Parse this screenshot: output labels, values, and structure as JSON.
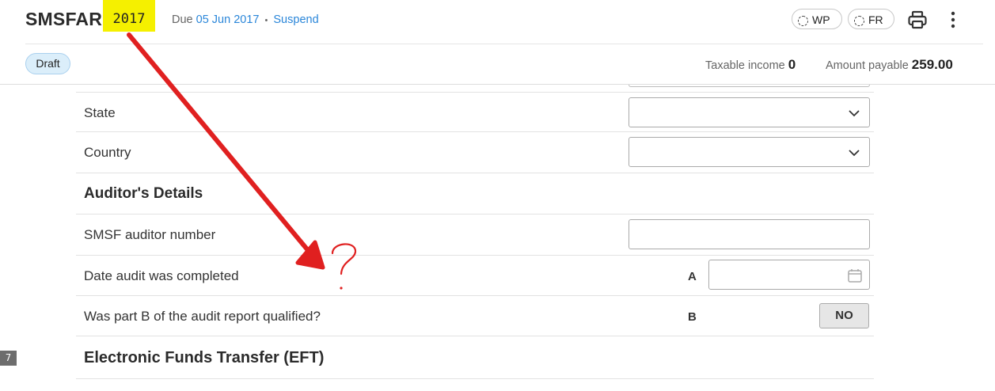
{
  "header": {
    "app_title": "SMSFAR",
    "year": "2017",
    "due_prefix": "Due",
    "due_date": "05 Jun 2017",
    "separator": "•",
    "suspend_link": "Suspend",
    "pills": [
      {
        "label": "WP",
        "icon": "dashed-circle-icon"
      },
      {
        "label": "FR",
        "icon": "dashed-circle-icon"
      }
    ],
    "status_badge": "Draft",
    "taxable_income_label": "Taxable income",
    "taxable_income_value": "0",
    "amount_payable_label": "Amount payable",
    "amount_payable_value": "259.00"
  },
  "form": {
    "state_label": "State",
    "country_label": "Country",
    "auditor_section_title": "Auditor's Details",
    "auditor_number_label": "SMSF auditor number",
    "date_audit_label": "Date audit was completed",
    "date_audit_code": "A",
    "part_b_label": "Was part B of the audit report qualified?",
    "part_b_code": "B",
    "part_b_value": "NO",
    "eft_section_title": "Electronic Funds Transfer (EFT)",
    "section_number": "7"
  },
  "annotation": {
    "color": "#e02020",
    "mark": "?"
  },
  "colors": {
    "link": "#2a86d9",
    "highlight": "#f5f000",
    "badge_bg": "#dbeefa"
  }
}
